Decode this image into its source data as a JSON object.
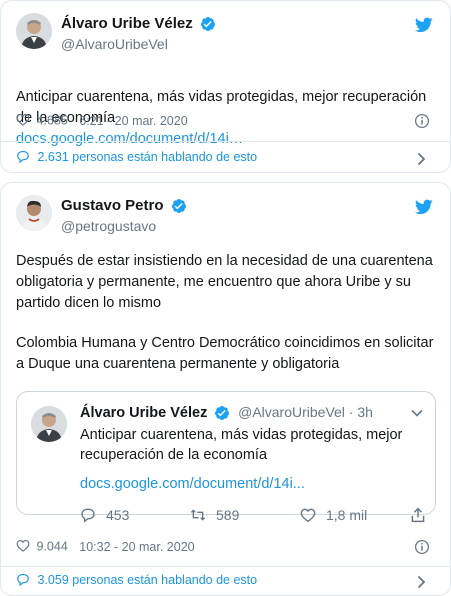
{
  "tweet1": {
    "author_name": "Álvaro Uribe Vélez",
    "author_handle": "@AlvaroUribeVel",
    "text": "Anticipar cuarentena, más vidas protegidas, mejor recuperación de la economía",
    "link": "docs.google.com/document/d/14i…",
    "likes": "4.685",
    "timestamp": "6:21 - 20 mar. 2020",
    "talking": "2.631 personas están hablando de esto"
  },
  "tweet2": {
    "author_name": "Gustavo Petro",
    "author_handle": "@petrogustavo",
    "paragraph1": "Después de estar insistiendo en la necesidad de una cuarentena obligatoria y permanente, me encuentro que ahora Uribe y su partido dicen lo mismo",
    "paragraph2": "Colombia Humana  y Centro Democrático coincidimos en solicitar a Duque una cuarentena permanente y obligatoria",
    "likes": "9.044",
    "timestamp": "10:32 - 20 mar. 2020",
    "talking": "3.059 personas están hablando de esto"
  },
  "quoted": {
    "author_name": "Álvaro Uribe Vélez",
    "author_handle": "@AlvaroUribeVel · 3h",
    "text": "Anticipar cuarentena, más vidas protegidas, mejor recuperación de la economía",
    "link": "docs.google.com/document/d/14i...",
    "replies": "453",
    "retweets": "589",
    "likes": "1,8 mil"
  },
  "colors": {
    "link": "#1b95e0",
    "verified": "#1da1f2",
    "muted": "#657786",
    "border": "#e1e8ed"
  }
}
